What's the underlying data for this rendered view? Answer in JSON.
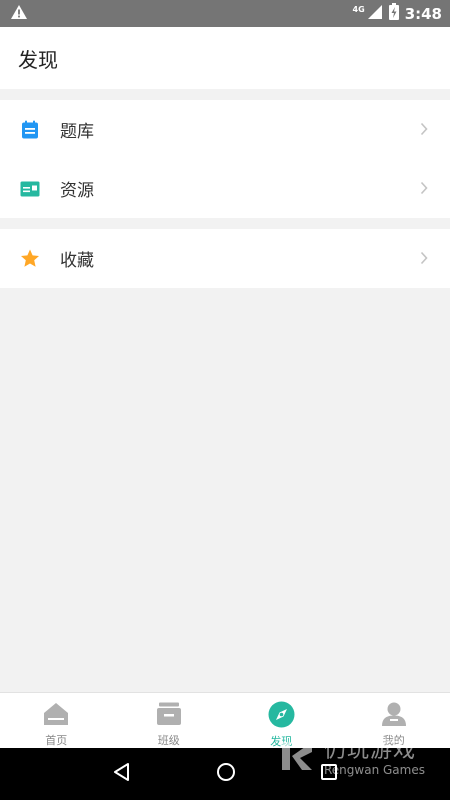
{
  "status_bar": {
    "warning_icon": "warning-triangle-icon",
    "network": "4G",
    "time": "3:48"
  },
  "header": {
    "title": "发现"
  },
  "groups": [
    {
      "items": [
        {
          "label": "题库",
          "icon": "calendar-list-icon",
          "color": "#2196f3"
        },
        {
          "label": "资源",
          "icon": "id-card-icon",
          "color": "#26b8a0"
        }
      ]
    },
    {
      "items": [
        {
          "label": "收藏",
          "icon": "star-icon",
          "color": "#ffa726"
        }
      ]
    }
  ],
  "tabbar": {
    "tabs": [
      {
        "label": "首页",
        "icon": "home-icon",
        "active": false
      },
      {
        "label": "班级",
        "icon": "class-icon",
        "active": false
      },
      {
        "label": "发现",
        "icon": "compass-icon",
        "active": true
      },
      {
        "label": "我的",
        "icon": "user-icon",
        "active": false
      }
    ],
    "active_color": "#26b8a0",
    "inactive_color": "#b0b0b0"
  },
  "watermark": {
    "title": "仍玩游戏",
    "subtitle": "Rengwan Games"
  }
}
